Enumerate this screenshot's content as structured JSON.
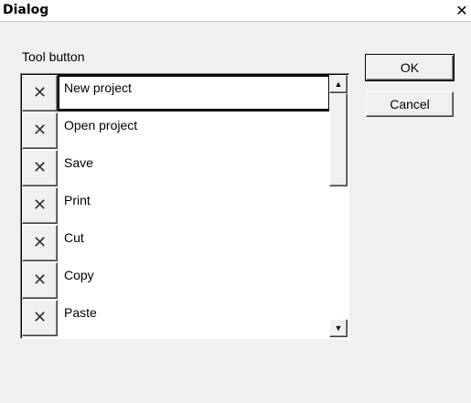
{
  "window": {
    "title": "Dialog",
    "close_glyph": "✕"
  },
  "group": {
    "label": "Tool button"
  },
  "list": {
    "items": [
      {
        "check": "✕",
        "label": "New project",
        "selected": true
      },
      {
        "check": "✕",
        "label": "Open project",
        "selected": false
      },
      {
        "check": "✕",
        "label": "Save",
        "selected": false
      },
      {
        "check": "✕",
        "label": "Print",
        "selected": false
      },
      {
        "check": "✕",
        "label": "Cut",
        "selected": false
      },
      {
        "check": "✕",
        "label": "Copy",
        "selected": false
      },
      {
        "check": "✕",
        "label": "Paste",
        "selected": false
      }
    ],
    "scroll_up_glyph": "▲",
    "scroll_down_glyph": "▼"
  },
  "buttons": {
    "ok": "OK",
    "cancel": "Cancel"
  }
}
